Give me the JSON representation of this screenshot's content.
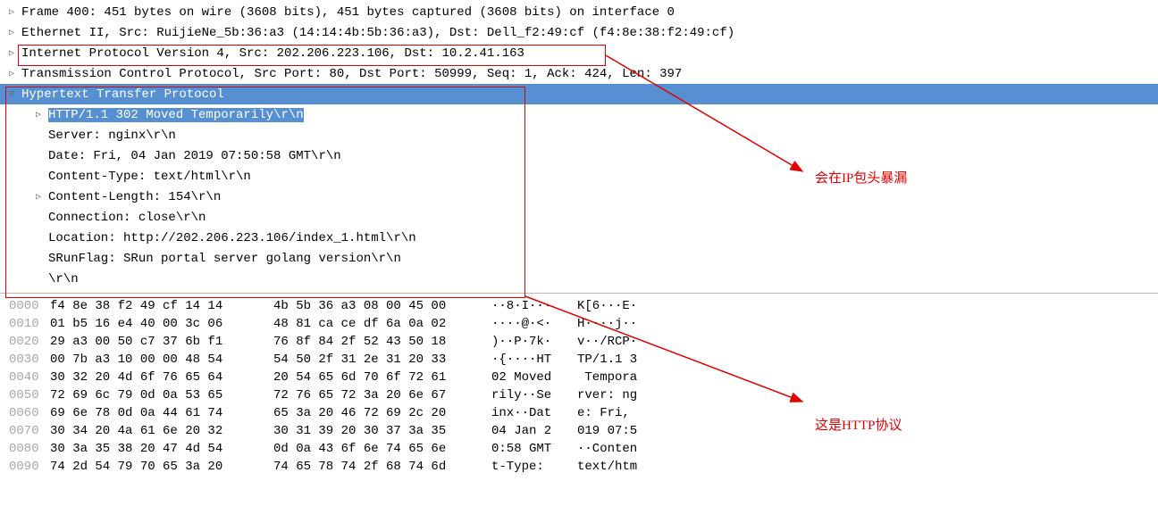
{
  "tree": {
    "frame": "Frame 400: 451 bytes on wire (3608 bits), 451 bytes captured (3608 bits) on interface 0",
    "eth": "Ethernet II, Src: RuijieNe_5b:36:a3 (14:14:4b:5b:36:a3), Dst: Dell_f2:49:cf (f4:8e:38:f2:49:cf)",
    "ip": "Internet Protocol Version 4, Src: 202.206.223.106, Dst: 10.2.41.163",
    "tcp": "Transmission Control Protocol, Src Port: 80, Dst Port: 50999, Seq: 1, Ack: 424, Len: 397",
    "http": "Hypertext Transfer Protocol",
    "status": "HTTP/1.1 302 Moved Temporarily\\r\\n",
    "server": "Server: nginx\\r\\n",
    "date": "Date: Fri, 04 Jan 2019 07:50:58 GMT\\r\\n",
    "ctype": "Content-Type: text/html\\r\\n",
    "clen": "Content-Length: 154\\r\\n",
    "conn": "Connection: close\\r\\n",
    "loc": "Location: http://202.206.223.106/index_1.html\\r\\n",
    "sflag": "SRunFlag: SRun portal server golang version\\r\\n",
    "crlf": "\\r\\n"
  },
  "hex": [
    {
      "off": "0000",
      "b1": "f4 8e 38 f2 49 cf 14 14",
      "b2": "4b 5b 36 a3 08 00 45 00",
      "a1": "··8·I···",
      "a2": "K[6···E·"
    },
    {
      "off": "0010",
      "b1": "01 b5 16 e4 40 00 3c 06",
      "b2": "48 81 ca ce df 6a 0a 02",
      "a1": "····@·<·",
      "a2": "H····j··"
    },
    {
      "off": "0020",
      "b1": "29 a3 00 50 c7 37 6b f1",
      "b2": "76 8f 84 2f 52 43 50 18",
      "a1": ")··P·7k·",
      "a2": "v··/RCP·"
    },
    {
      "off": "0030",
      "b1": "00 7b a3 10 00 00 48 54",
      "b2": "54 50 2f 31 2e 31 20 33",
      "a1": "·{····HT",
      "a2": "TP/1.1 3"
    },
    {
      "off": "0040",
      "b1": "30 32 20 4d 6f 76 65 64",
      "b2": "20 54 65 6d 70 6f 72 61",
      "a1": "02 Moved",
      "a2": " Tempora"
    },
    {
      "off": "0050",
      "b1": "72 69 6c 79 0d 0a 53 65",
      "b2": "72 76 65 72 3a 20 6e 67",
      "a1": "rily··Se",
      "a2": "rver: ng"
    },
    {
      "off": "0060",
      "b1": "69 6e 78 0d 0a 44 61 74",
      "b2": "65 3a 20 46 72 69 2c 20",
      "a1": "inx··Dat",
      "a2": "e: Fri, "
    },
    {
      "off": "0070",
      "b1": "30 34 20 4a 61 6e 20 32",
      "b2": "30 31 39 20 30 37 3a 35",
      "a1": "04 Jan 2",
      "a2": "019 07:5"
    },
    {
      "off": "0080",
      "b1": "30 3a 35 38 20 47 4d 54",
      "b2": "0d 0a 43 6f 6e 74 65 6e",
      "a1": "0:58 GMT",
      "a2": "··Conten"
    },
    {
      "off": "0090",
      "b1": "74 2d 54 79 70 65 3a 20",
      "b2": "74 65 78 74 2f 68 74 6d",
      "a1": "t-Type: ",
      "a2": "text/htm"
    }
  ],
  "annotations": {
    "ip_leak": "会在IP包头暴漏",
    "http_proto": "这是HTTP协议"
  },
  "colors": {
    "highlight": "#5690d2",
    "red": "#e30000",
    "offset_grey": "#a7a7a7"
  }
}
